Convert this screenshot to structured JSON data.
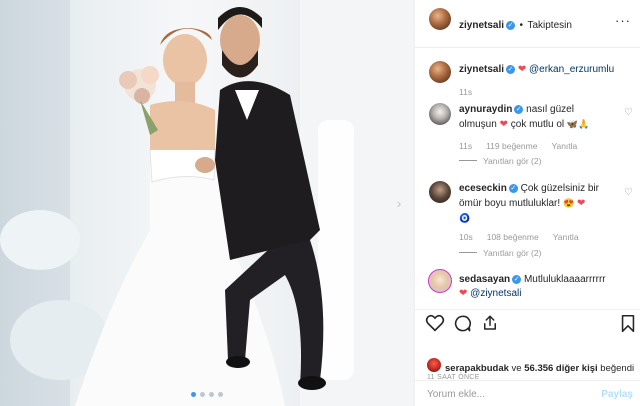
{
  "post": {
    "username": "ziynetsali",
    "follow_dot": "•",
    "follow_label": "Takiptesin",
    "more_icon": "more-horizontal-icon"
  },
  "caption": {
    "username": "ziynetsali",
    "mention": "@erkan_erzurumlu",
    "time": "11s"
  },
  "comments": [
    {
      "username": "aynuraydin",
      "text_line1": "nasıl güzel",
      "text_line2": "olmuşun",
      "text_line2b": "çok mutlu ol",
      "time": "11s",
      "likes": "119 beğenme",
      "reply": "Yanıtla",
      "view_replies": "Yanıtları gör (2)"
    },
    {
      "username": "eceseckin",
      "text_line1": "Çok güzelsiniz bir",
      "text_line2": "ömür boyu mutluluklar!",
      "time": "10s",
      "likes": "108 beğenme",
      "reply": "Yanıtla",
      "view_replies": "Yanıtları gör (2)"
    },
    {
      "username": "sedasayan",
      "text_line1": "Mutluluklaaaarrrrrr",
      "mention": "@ziynetsali"
    }
  ],
  "likes": {
    "user": "serapakbudak",
    "connector": "ve",
    "others": "56.356 diğer kişi",
    "suffix": "beğendi"
  },
  "timestamp": "11 SAAT ÖNCE",
  "comment_input": {
    "placeholder": "Yorum ekle...",
    "post_label": "Paylaş"
  },
  "colors": {
    "accent_blue": "#3897f0",
    "heart_red": "#ed4956",
    "muted_text": "#999999"
  }
}
